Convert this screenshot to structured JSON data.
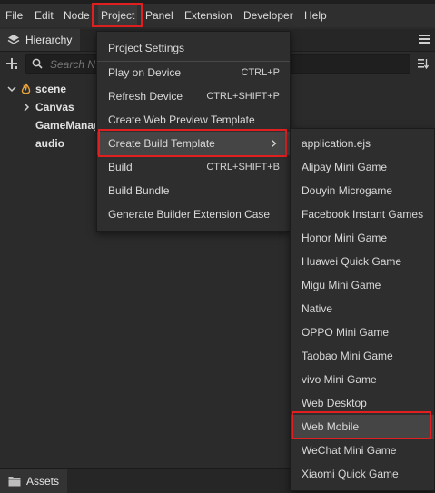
{
  "menubar": {
    "items": [
      "File",
      "Edit",
      "Node",
      "Project",
      "Panel",
      "Extension",
      "Developer",
      "Help"
    ]
  },
  "hierarchy": {
    "tab_label": "Hierarchy",
    "search_placeholder": "Search N",
    "tree": [
      {
        "label": "scene"
      },
      {
        "label": "Canvas"
      },
      {
        "label": "GameManag"
      },
      {
        "label": "audio"
      }
    ]
  },
  "assets": {
    "tab_label": "Assets"
  },
  "project_menu": {
    "items": [
      {
        "label": "Project Settings",
        "shortcut": ""
      },
      {
        "label": "Play on Device",
        "shortcut": "CTRL+P"
      },
      {
        "label": "Refresh Device",
        "shortcut": "CTRL+SHIFT+P"
      },
      {
        "label": "Create Web Preview Template",
        "shortcut": ""
      },
      {
        "label": "Create Build Template",
        "shortcut": ""
      },
      {
        "label": "Build",
        "shortcut": "CTRL+SHIFT+B"
      },
      {
        "label": "Build Bundle",
        "shortcut": ""
      },
      {
        "label": "Generate Builder Extension Case",
        "shortcut": ""
      }
    ]
  },
  "build_template_submenu": {
    "items": [
      "application.ejs",
      "Alipay Mini Game",
      "Douyin Microgame",
      "Facebook Instant Games",
      "Honor Mini Game",
      "Huawei Quick Game",
      "Migu Mini Game",
      "Native",
      "OPPO Mini Game",
      "Taobao Mini Game",
      "vivo Mini Game",
      "Web Desktop",
      "Web Mobile",
      "WeChat Mini Game",
      "Xiaomi Quick Game"
    ]
  },
  "colors": {
    "highlight_border": "#e02020",
    "menu_bg": "#2e2e2e",
    "active_item_bg": "#454545",
    "scene_icon": "#e8a33a"
  }
}
